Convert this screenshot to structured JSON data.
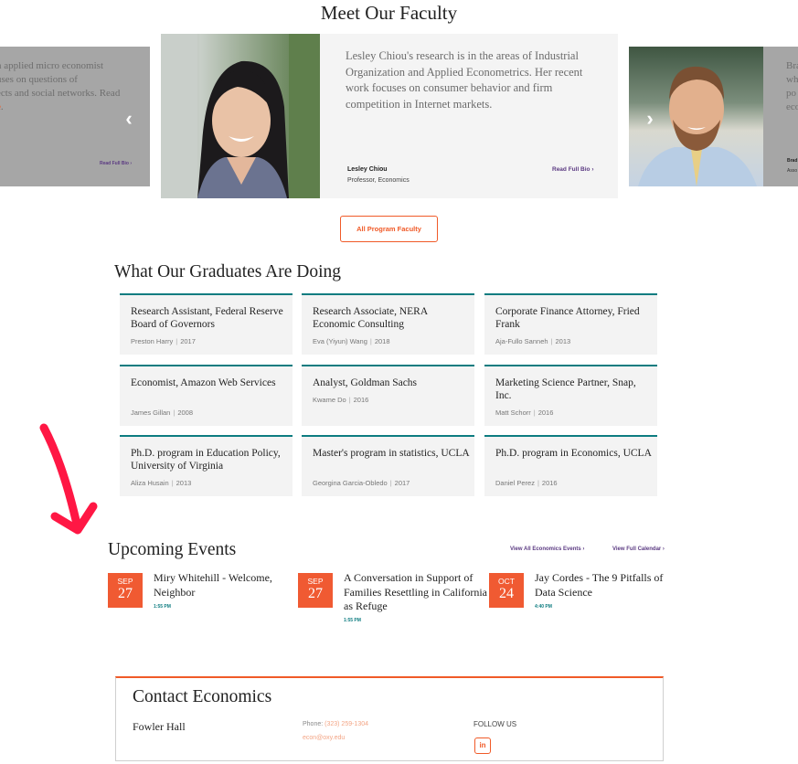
{
  "colors": {
    "accent_orange": "#f05a28",
    "teal": "#0d7c80",
    "purple_link": "#5b3a82",
    "annotation_red": "#ff1744"
  },
  "faculty": {
    "title": "Meet Our Faculty",
    "prev_icon": "chevron-left-icon",
    "next_icon": "chevron-right-icon",
    "prev_glyph": "‹",
    "next_glyph": "›",
    "left_card": {
      "bio_lines": [
        "n applied micro economist",
        "uses on questions of",
        "ects and social networks. Read"
      ],
      "bio_link_fragment": "e",
      "bio_link_suffix": ".",
      "read_bio": "Read Full Bio  ›"
    },
    "main_card": {
      "bio": "Lesley Chiou's research is in the areas of Industrial Organization and Applied Econometrics. Her recent work focuses on consumer behavior and firm competition in Internet markets.",
      "name": "Lesley Chiou",
      "role": "Professor, Economics",
      "read_bio": "Read Full Bio  ›"
    },
    "right_card": {
      "bio_lines": [
        "Bra",
        "wh",
        "po",
        "eco"
      ],
      "name": "Brad",
      "role": "Asso"
    },
    "all_faculty_button": "All Program Faculty"
  },
  "graduates": {
    "title": "What Our Graduates Are Doing",
    "items": [
      {
        "job": "Research Assistant, Federal Reserve Board of Governors",
        "name": "Preston Harry",
        "year": "2017"
      },
      {
        "job": "Research Associate, NERA Economic Consulting",
        "name": "Eva (Yiyun) Wang",
        "year": "2018"
      },
      {
        "job": "Corporate Finance Attorney, Fried Frank",
        "name": "Aja-Fullo Sanneh",
        "year": "2013"
      },
      {
        "job": "Economist, Amazon Web Services",
        "name": "James Gillan",
        "year": "2008"
      },
      {
        "job": "Analyst, Goldman Sachs",
        "name": "Kwame Do",
        "year": "2016"
      },
      {
        "job": "Marketing Science Partner, Snap, Inc.",
        "name": "Matt Schorr",
        "year": "2016"
      },
      {
        "job": "Ph.D. program in Education Policy, University of Virginia",
        "name": "Aliza Husain",
        "year": "2013"
      },
      {
        "job": "Master's program in statistics, UCLA",
        "name": "Georgina Garcia-Obledo",
        "year": "2017"
      },
      {
        "job": "Ph.D. program in Economics, UCLA",
        "name": "Daniel Perez",
        "year": "2016"
      }
    ],
    "separator": "|"
  },
  "events": {
    "title": "Upcoming Events",
    "view_all": "View All Economics Events  ›",
    "view_calendar": "View Full Calendar  ›",
    "items": [
      {
        "month": "SEP",
        "day": "27",
        "title": "Miry Whitehill - Welcome, Neighbor",
        "time": "1:55 PM"
      },
      {
        "month": "SEP",
        "day": "27",
        "title": "A Conversation in Support of Families Resettling in California as Refuge",
        "time": "1:55 PM"
      },
      {
        "month": "OCT",
        "day": "24",
        "title": "Jay Cordes - The 9 Pitfalls of Data Science",
        "time": "4:40 PM"
      }
    ]
  },
  "contact": {
    "title": "Contact Economics",
    "location": "Fowler Hall",
    "phone_label": "Phone:",
    "phone": "(323) 259-1304",
    "email": "econ@oxy.edu",
    "follow_label": "FOLLOW US",
    "linkedin_icon": "linkedin-icon",
    "linkedin_glyph": "in"
  },
  "annotation": {
    "icon": "hand-drawn-arrow-icon"
  }
}
